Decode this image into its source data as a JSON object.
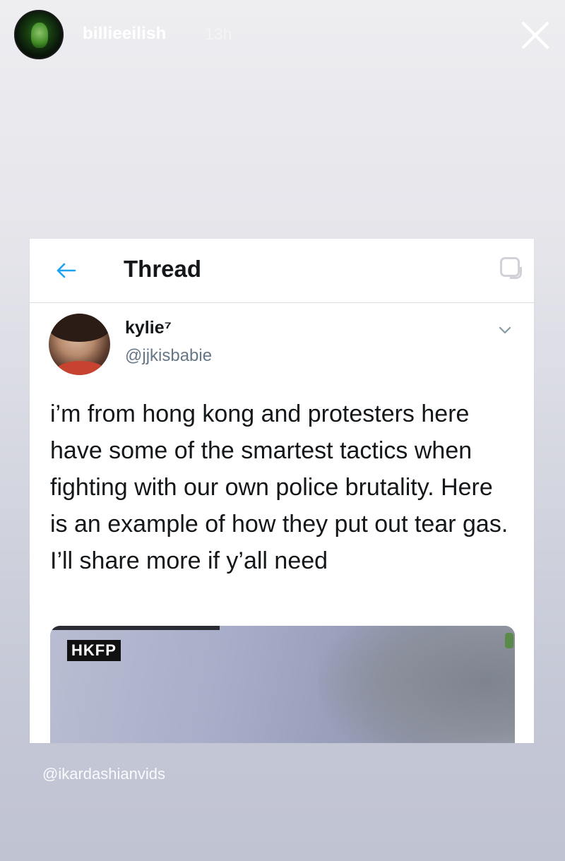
{
  "story": {
    "username": "billieeilish",
    "time": "13h",
    "credit": "@ikardashianvids"
  },
  "thread": {
    "title": "Thread"
  },
  "tweet": {
    "author_name": "kylie⁷",
    "author_handle": "@jjkisbabie",
    "text": "i’m from hong kong and protesters here have some of the smartest tactics when fighting with our own police brutality. Here is an example of how they put out tear gas. I’ll share more if y’all need",
    "media_badge": "HKFP"
  },
  "icons": {
    "close": "close-icon",
    "back": "back-arrow-icon",
    "chevron": "chevron-down-icon",
    "corner": "copy-icon"
  },
  "colors": {
    "text_primary": "#14171a",
    "text_secondary": "#657786",
    "accent": "#1da1f2"
  }
}
